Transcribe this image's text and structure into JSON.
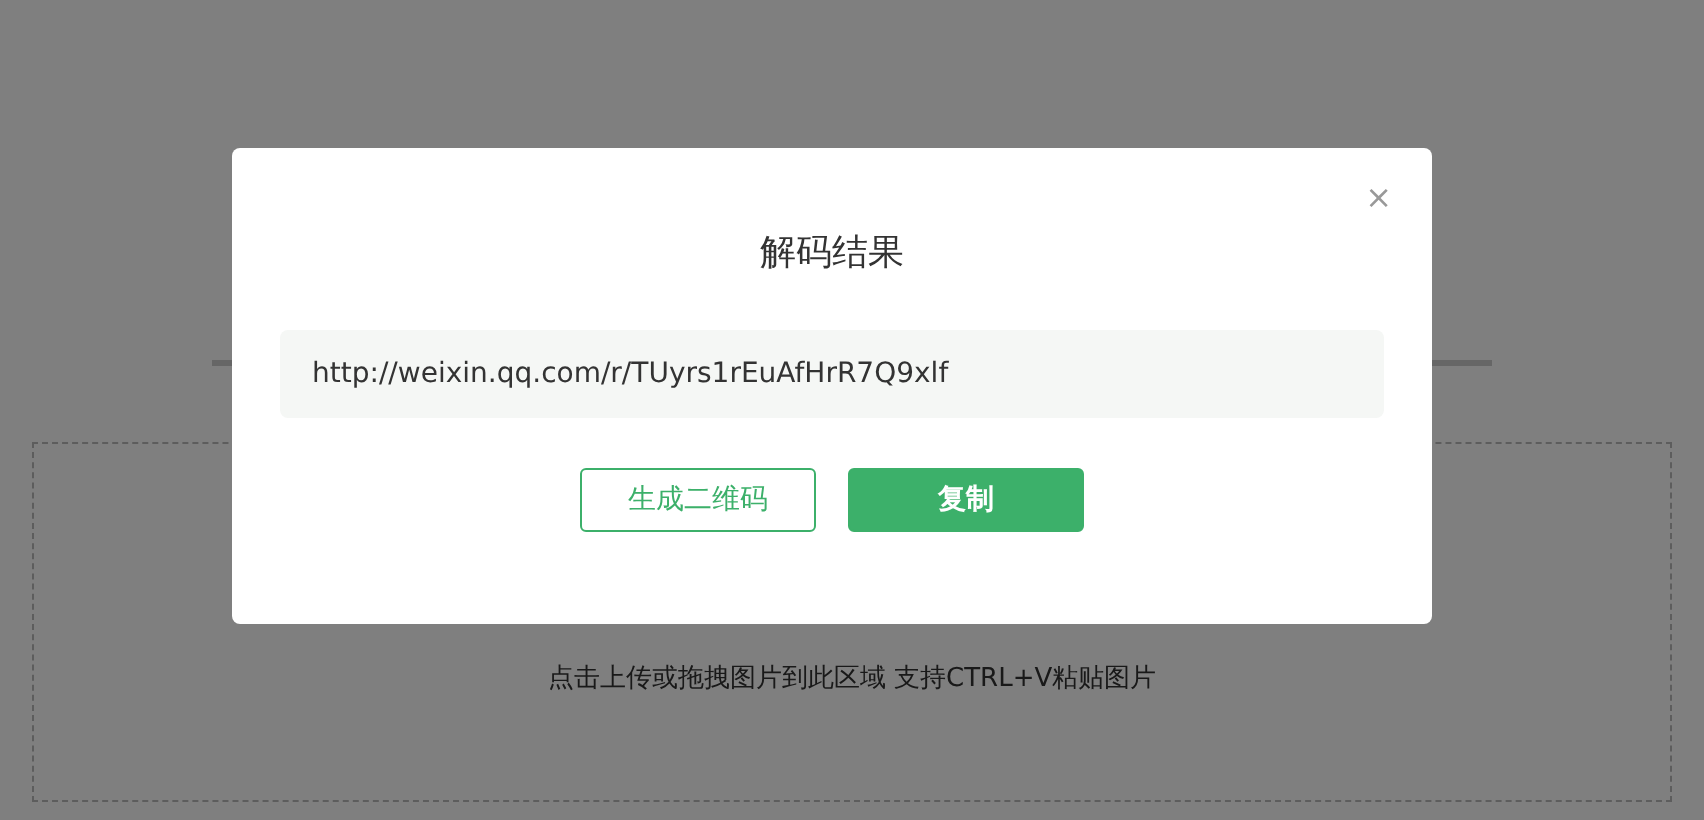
{
  "page": {
    "upload_hint": "点击上传或拖拽图片到此区域 支持CTRL+V粘贴图片"
  },
  "dialog": {
    "title": "解码结果",
    "close": "×",
    "result": "http://weixin.qq.com/r/TUyrs1rEuAfHrR7Q9xlf",
    "buttons": [
      {
        "label": "生成二维码",
        "kind": "outline"
      },
      {
        "label": "复制",
        "kind": "primary"
      }
    ]
  }
}
